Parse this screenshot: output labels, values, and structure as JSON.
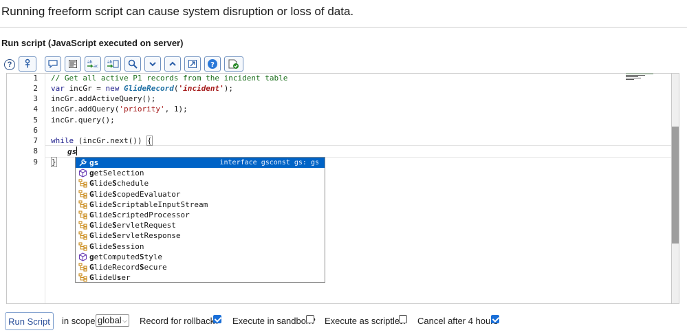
{
  "warning_text": "Running freeform script can cause system disruption or loss of data.",
  "section_title": "Run script (JavaScript executed on server)",
  "toolbar": {
    "icons": [
      "help-icon",
      "script-include-icon",
      "comment-icon",
      "format-icon",
      "replace-icon",
      "replace-all-icon",
      "search-icon",
      "down-arrow-icon",
      "up-arrow-icon",
      "fullscreen-icon",
      "help-circle-icon",
      "check-syntax-icon"
    ]
  },
  "editor": {
    "line_numbers": [
      "1",
      "2",
      "3",
      "4",
      "5",
      "6",
      "7",
      "8",
      "9"
    ],
    "line1_comment": "// Get all active P1 records from the incident table",
    "line2_var": "var",
    "line2_name": " incGr = ",
    "line2_new": "new",
    "line2_type": " GlideRecord",
    "line2_paren1": "(",
    "line2_str": "'incident'",
    "line2_end": ");",
    "line3": "incGr.addActiveQuery();",
    "line4_pre": "incGr.addQuery(",
    "line4_str": "'priority'",
    "line4_post": ", 1);",
    "line5": "incGr.query();",
    "line7_kw": "while",
    "line7_rest": " (incGr.next()) ",
    "line7_brace": "{",
    "line8": "gs",
    "line9": "}"
  },
  "autocomplete": {
    "detail": "interface gsconst gs: gs",
    "items": [
      {
        "pre": "",
        "match": "gs",
        "post": "",
        "icon": "wrench"
      },
      {
        "pre": "",
        "match": "g",
        "post": "etSelection",
        "icon": "cube"
      },
      {
        "pre": "",
        "match": "G",
        "post": "lide",
        "match2": "S",
        "post2": "chedule",
        "icon": "class"
      },
      {
        "pre": "",
        "match": "G",
        "post": "lide",
        "match2": "S",
        "post2": "copedEvaluator",
        "icon": "class"
      },
      {
        "pre": "",
        "match": "G",
        "post": "lide",
        "match2": "S",
        "post2": "criptableInputStream",
        "icon": "class"
      },
      {
        "pre": "",
        "match": "G",
        "post": "lide",
        "match2": "S",
        "post2": "criptedProcessor",
        "icon": "class"
      },
      {
        "pre": "",
        "match": "G",
        "post": "lide",
        "match2": "S",
        "post2": "ervletRequest",
        "icon": "class"
      },
      {
        "pre": "",
        "match": "G",
        "post": "lide",
        "match2": "S",
        "post2": "ervletResponse",
        "icon": "class"
      },
      {
        "pre": "",
        "match": "G",
        "post": "lide",
        "match2": "S",
        "post2": "ession",
        "icon": "class"
      },
      {
        "pre": "",
        "match": "g",
        "post": "etComputed",
        "match2": "S",
        "post2": "tyle",
        "icon": "cube"
      },
      {
        "pre": "",
        "match": "G",
        "post": "lideRecord",
        "match2": "S",
        "post2": "ecure",
        "icon": "class"
      },
      {
        "pre": "",
        "match": "G",
        "post": "lideU",
        "match2": "s",
        "post2": "er",
        "icon": "class"
      }
    ]
  },
  "bottom": {
    "run_button": "Run Script",
    "scope_label": "in scope",
    "scope_value": "global",
    "rollback_label": "Record for rollback?",
    "rollback_checked": true,
    "sandbox_label": "Execute in sandbox?",
    "sandbox_checked": false,
    "scriptlet_label": "Execute as scriptlet?",
    "scriptlet_checked": false,
    "cancel_label": "Cancel after 4 hours",
    "cancel_checked": true
  },
  "colors": {
    "accent": "#0063c6",
    "checkbox": "#1a6fd8",
    "comment": "#1a6e1a",
    "string": "#a31515"
  }
}
